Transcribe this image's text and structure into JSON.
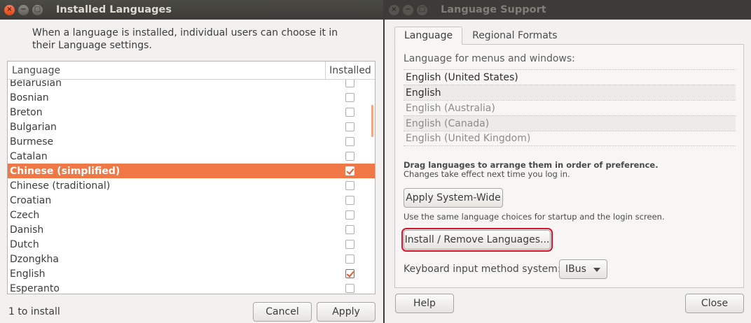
{
  "installed_window": {
    "title": "Installed Languages",
    "intro": "When a language is installed, individual users can choose it in their Language settings.",
    "columns": {
      "language": "Language",
      "installed": "Installed"
    },
    "languages": [
      {
        "name": "Belarusian",
        "installed": false
      },
      {
        "name": "Bosnian",
        "installed": false
      },
      {
        "name": "Breton",
        "installed": false
      },
      {
        "name": "Bulgarian",
        "installed": false
      },
      {
        "name": "Burmese",
        "installed": false
      },
      {
        "name": "Catalan",
        "installed": false
      },
      {
        "name": "Chinese (simplified)",
        "installed": true,
        "selected": true
      },
      {
        "name": "Chinese (traditional)",
        "installed": false
      },
      {
        "name": "Croatian",
        "installed": false
      },
      {
        "name": "Czech",
        "installed": false
      },
      {
        "name": "Danish",
        "installed": false
      },
      {
        "name": "Dutch",
        "installed": false
      },
      {
        "name": "Dzongkha",
        "installed": false
      },
      {
        "name": "English",
        "installed": true
      },
      {
        "name": "Esperanto",
        "installed": false
      }
    ],
    "status": "1 to install",
    "cancel_label": "Cancel",
    "apply_label": "Apply"
  },
  "support_window": {
    "title": "Language Support",
    "tabs": [
      {
        "label": "Language",
        "active": true
      },
      {
        "label": "Regional Formats",
        "active": false
      }
    ],
    "menus_label": "Language for menus and windows:",
    "menu_languages": [
      {
        "name": "English (United States)",
        "active": true
      },
      {
        "name": "English",
        "active": true
      },
      {
        "name": "English (Australia)",
        "active": false
      },
      {
        "name": "English (Canada)",
        "active": false
      },
      {
        "name": "English (United Kingdom)",
        "active": false
      }
    ],
    "drag_hint_bold": "Drag languages to arrange them in order of preference.",
    "drag_hint_sub": "Changes take effect next time you log in.",
    "apply_system_label": "Apply System-Wide",
    "same_lang_text": "Use the same language choices for startup and the login screen.",
    "install_remove_label": "Install / Remove Languages...",
    "keyboard_label": "Keyboard input method system:",
    "keyboard_value": "IBus",
    "help_label": "Help",
    "close_label": "Close"
  },
  "colors": {
    "selection": "#f07746",
    "highlight_border": "#d4142a",
    "titlebar": "#3c3b37"
  }
}
